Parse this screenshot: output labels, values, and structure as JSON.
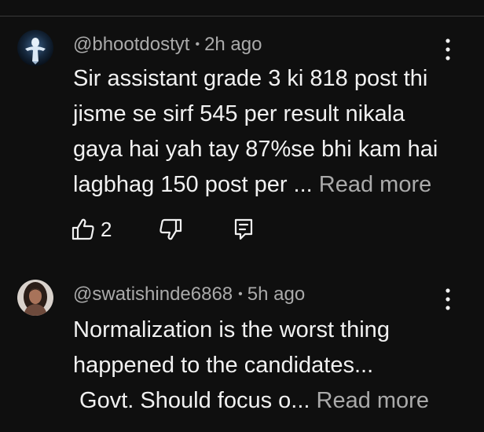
{
  "comments": [
    {
      "username": "@bhootdostyt",
      "separator": "•",
      "time": "2h ago",
      "lines": [
        "Sir assistant grade 3 ki 818 post thi",
        "jisme se sirf 545 per result nikala",
        "gaya hai yah tay 87%se bhi kam hai",
        "lagbhag 150 post per ... "
      ],
      "read_more": "Read more",
      "likes": "2",
      "avatar_icon": "ghost-figure-avatar",
      "menu_icon": "more-vertical-icon"
    },
    {
      "username": "@swatishinde6868",
      "separator": "•",
      "time": "5h ago",
      "lines": [
        "Normalization is the worst thing",
        "happened to the candidates...",
        " Govt. Should focus o... "
      ],
      "read_more": "Read more",
      "avatar_icon": "profile-photo-avatar",
      "menu_icon": "more-vertical-icon"
    }
  ],
  "action_icons": [
    "thumbs-up-icon",
    "thumbs-down-icon",
    "reply-icon"
  ],
  "colors": {
    "background": "#0f0f0f",
    "primary_text": "#f1f1f1",
    "secondary_text": "#aaaaaa",
    "divider": "#3a3a3a"
  }
}
